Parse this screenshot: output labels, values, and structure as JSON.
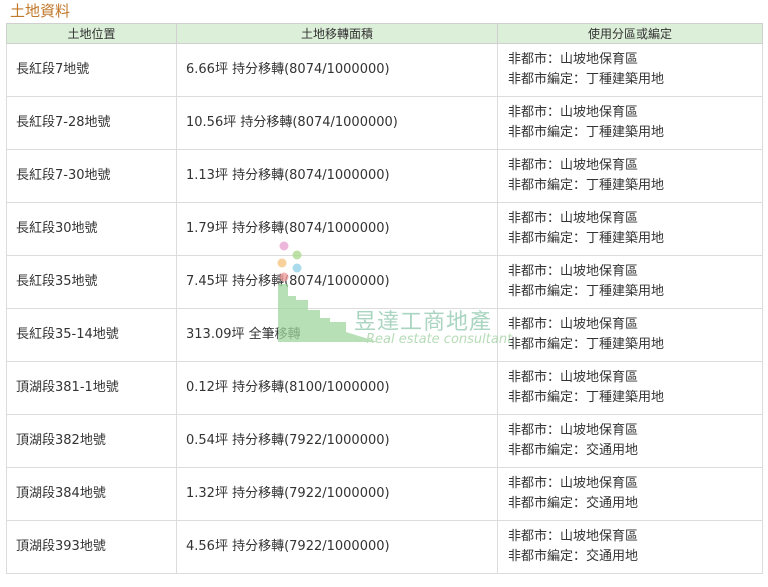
{
  "section": {
    "title": "土地資料"
  },
  "table": {
    "headers": [
      "土地位置",
      "土地移轉面積",
      "使用分區或編定"
    ],
    "rows": [
      {
        "location": "長紅段7地號",
        "area": "6.66坪 持分移轉(8074/1000000)",
        "zone": "非都市：山坡地保育區",
        "designation": "非都市編定：丁種建築用地"
      },
      {
        "location": "長紅段7-28地號",
        "area": "10.56坪 持分移轉(8074/1000000)",
        "zone": "非都市：山坡地保育區",
        "designation": "非都市編定：丁種建築用地"
      },
      {
        "location": "長紅段7-30地號",
        "area": "1.13坪 持分移轉(8074/1000000)",
        "zone": "非都市：山坡地保育區",
        "designation": "非都市編定：丁種建築用地"
      },
      {
        "location": "長紅段30地號",
        "area": "1.79坪 持分移轉(8074/1000000)",
        "zone": "非都市：山坡地保育區",
        "designation": "非都市編定：丁種建築用地"
      },
      {
        "location": "長紅段35地號",
        "area": "7.45坪 持分移轉(8074/1000000)",
        "zone": "非都市：山坡地保育區",
        "designation": "非都市編定：丁種建築用地"
      },
      {
        "location": "長紅段35-14地號",
        "area": "313.09坪 全筆移轉",
        "zone": "非都市：山坡地保育區",
        "designation": "非都市編定：丁種建築用地"
      },
      {
        "location": "頂湖段381-1地號",
        "area": "0.12坪 持分移轉(8100/1000000)",
        "zone": "非都市：山坡地保育區",
        "designation": "非都市編定：丁種建築用地"
      },
      {
        "location": "頂湖段382地號",
        "area": "0.54坪 持分移轉(7922/1000000)",
        "zone": "非都市：山坡地保育區",
        "designation": "非都市編定：交通用地"
      },
      {
        "location": "頂湖段384地號",
        "area": "1.32坪 持分移轉(7922/1000000)",
        "zone": "非都市：山坡地保育區",
        "designation": "非都市編定：交通用地"
      },
      {
        "location": "頂湖段393地號",
        "area": "4.56坪 持分移轉(7922/1000000)",
        "zone": "非都市：山坡地保育區",
        "designation": "非都市編定：交通用地"
      }
    ]
  },
  "watermark": {
    "name": "昱達工商地產",
    "tagline": "Real estate consultant",
    "logo_icon": "dots-and-skyline-logo",
    "dot_colors": [
      "#e8a0d0",
      "#a8d88a",
      "#f4c27a",
      "#8ecfe8",
      "#f09a9a"
    ],
    "skyline_color": "#9fd6a0"
  }
}
